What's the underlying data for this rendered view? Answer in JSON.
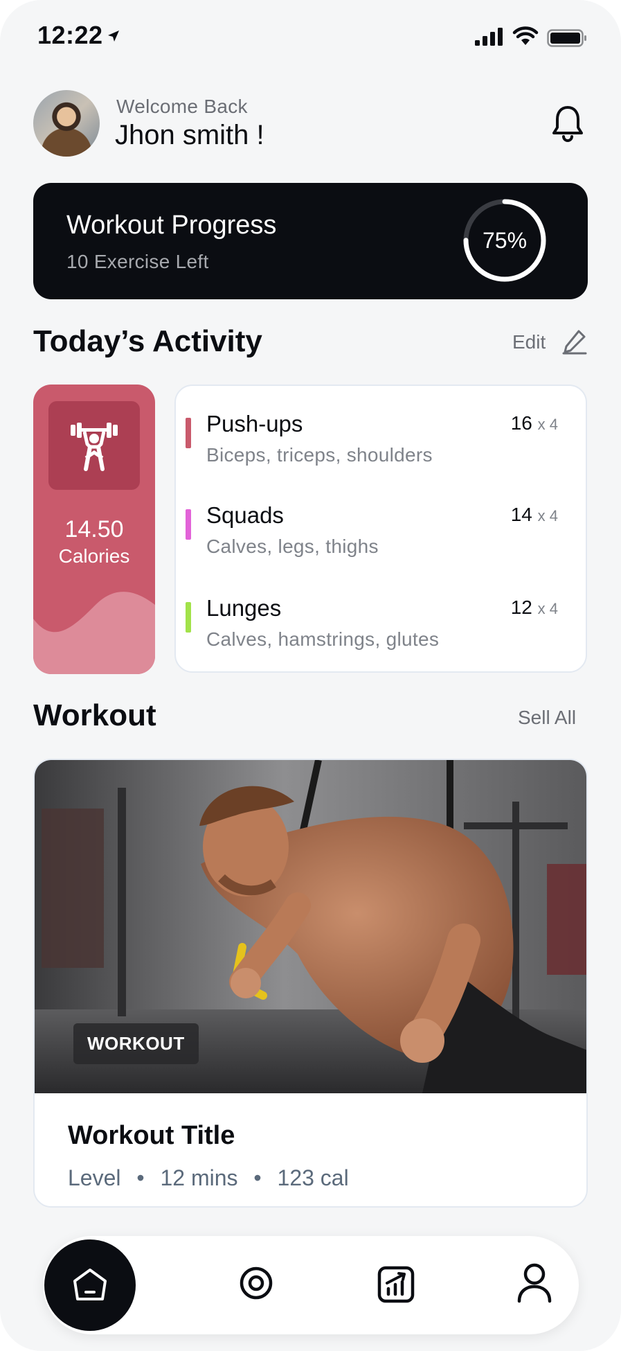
{
  "status_bar": {
    "time": "12:22",
    "icons": [
      "location-arrow-icon",
      "cellular-signal-icon",
      "wifi-icon",
      "battery-icon"
    ]
  },
  "header": {
    "welcome": "Welcome Back",
    "username": "Jhon smith !",
    "notification_icon": "bell-icon"
  },
  "progress": {
    "title": "Workout Progress",
    "subtitle": "10 Exercise Left",
    "percent_label": "75%",
    "percent_value": 0.75
  },
  "activity": {
    "title": "Today’s Activity",
    "edit_label": "Edit",
    "calories_value": "14.50",
    "calories_label": "Calories",
    "exercises": [
      {
        "name": "Push-ups",
        "muscles": "Biceps, triceps, shoulders",
        "reps": "16",
        "sets": "x 4",
        "color": "#c95a6c"
      },
      {
        "name": "Squads",
        "muscles": "Calves, legs, thighs",
        "reps": "14",
        "sets": "x 4",
        "color": "#e263d8"
      },
      {
        "name": "Lunges",
        "muscles": "Calves, hamstrings, glutes",
        "reps": "12",
        "sets": "x 4",
        "color": "#a2e24a"
      }
    ]
  },
  "workout": {
    "title": "Workout",
    "see_all_label": "Sell All",
    "card": {
      "tag": "WORKOUT",
      "title": "Workout Title",
      "level": "Level",
      "duration": "12 mins",
      "calories": "123 cal",
      "separator": "•"
    }
  },
  "bottom_nav": {
    "items": [
      "home-icon",
      "target-icon",
      "stats-icon",
      "profile-icon"
    ],
    "active": "home-icon"
  },
  "colors": {
    "accent_dark": "#0b0d12",
    "calories_card": "#c95a6c",
    "background": "#f5f6f7"
  }
}
